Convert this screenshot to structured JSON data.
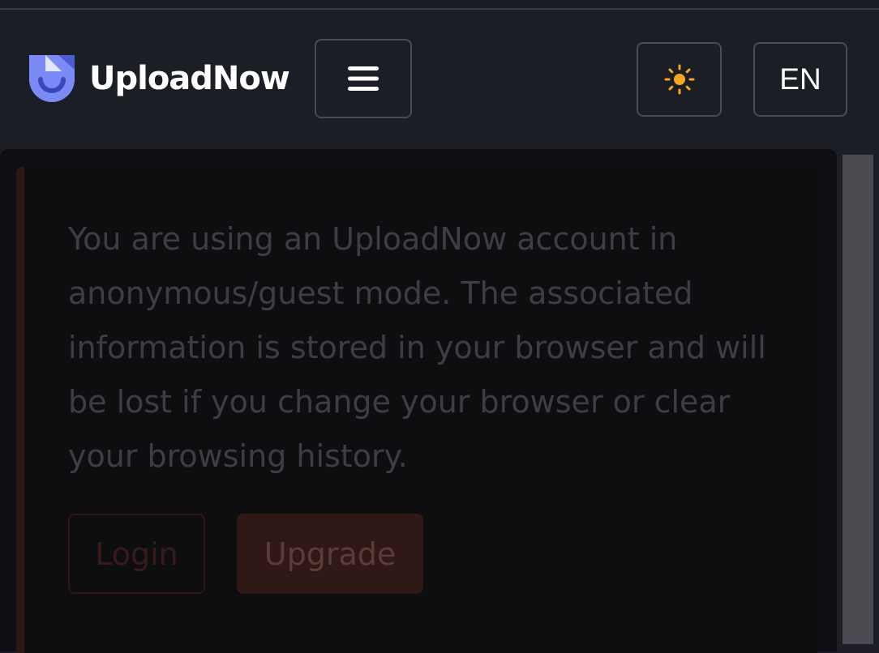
{
  "header": {
    "brand": "UploadNow",
    "language": "EN",
    "icons": {
      "logo": "uploadnow-logo-icon",
      "menu": "hamburger-menu-icon",
      "theme": "sun-icon"
    }
  },
  "alert": {
    "message": "You are using an UploadNow account in anonymous/guest mode. The associated information is stored in your browser and will be lost if you change your browser or clear your browsing history.",
    "login_label": "Login",
    "upgrade_label": "Upgrade"
  },
  "colors": {
    "header_bg": "#1c1e26",
    "content_bg": "#0f0f13",
    "sun_accent": "#f5a623",
    "logo_accent": "#6f7df0",
    "alert_border": "#2c1715"
  }
}
